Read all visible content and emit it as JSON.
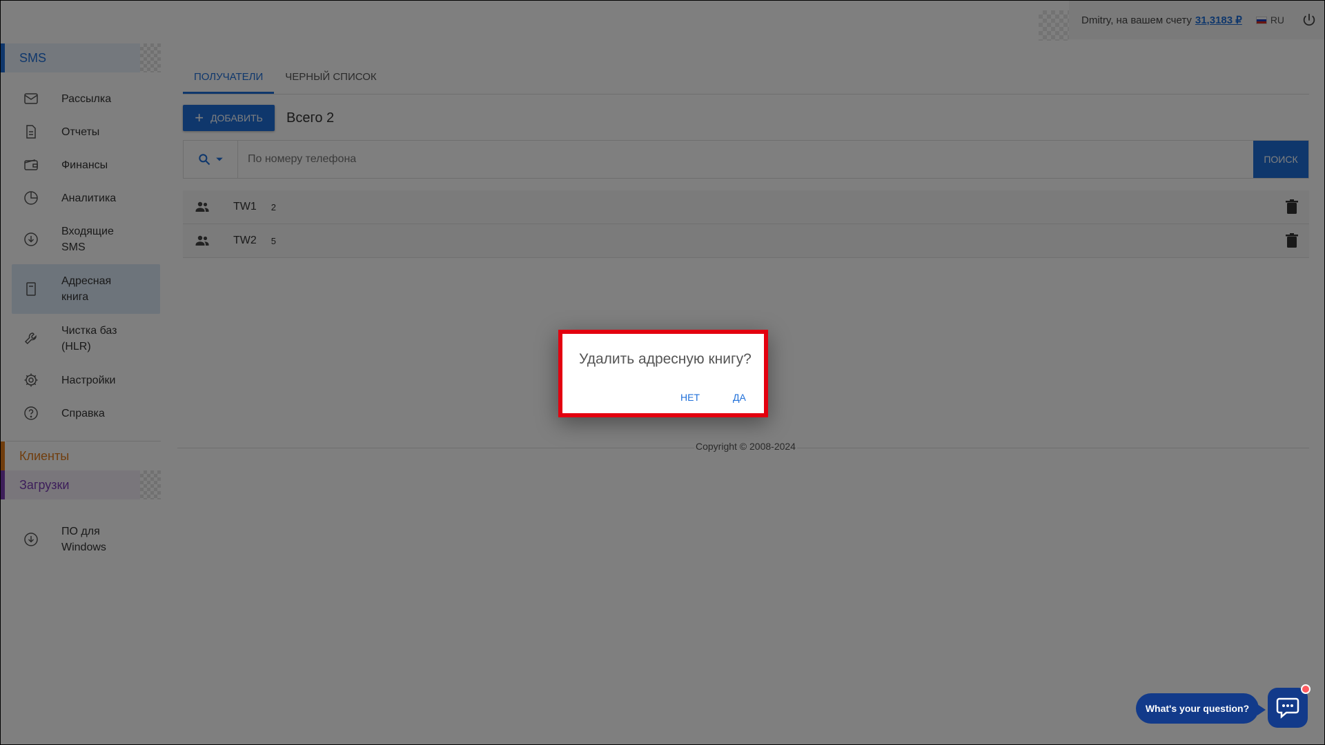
{
  "topbar": {
    "greeting": "Dmitry, на вашем счету",
    "balance": "31,3183 ₽",
    "lang": "RU"
  },
  "sidebar": {
    "sms_header": "SMS",
    "items": [
      {
        "label": "Рассылка",
        "icon": "mail-icon"
      },
      {
        "label": "Отчеты",
        "icon": "document-icon"
      },
      {
        "label": "Финансы",
        "icon": "wallet-icon"
      },
      {
        "label": "Аналитика",
        "icon": "pie-chart-icon"
      },
      {
        "label": "Входящие SMS",
        "icon": "inbox-download-icon"
      },
      {
        "label": "Адресная книга",
        "icon": "address-book-icon"
      },
      {
        "label": "Чистка баз (HLR)",
        "icon": "wrench-icon"
      },
      {
        "label": "Настройки",
        "icon": "gear-icon"
      },
      {
        "label": "Справка",
        "icon": "help-icon"
      }
    ],
    "clients_header": "Клиенты",
    "downloads_header": "Загрузки",
    "software_item": "ПО для Windows"
  },
  "main": {
    "tabs": [
      "ПОЛУЧАТЕЛИ",
      "ЧЕРНЫЙ СПИСОК"
    ],
    "add_label": "ДОБАВИТЬ",
    "total_label": "Всего 2",
    "search_placeholder": "По номеру телефона",
    "search_button": "ПОИСК",
    "rows": [
      {
        "name": "TW1",
        "count": "2"
      },
      {
        "name": "TW2",
        "count": "5"
      }
    ]
  },
  "footer": {
    "copyright": "Copyright © 2008-2024"
  },
  "dialog": {
    "title": "Удалить адресную книгу?",
    "no": "НЕТ",
    "yes": "ДА"
  },
  "chat": {
    "prompt": "What's your question?"
  },
  "colors": {
    "accent": "#1e6fd9",
    "clients": "#e07b1a",
    "downloads": "#7b3db5",
    "highlight": "#e3000f",
    "chat": "#123a8a"
  }
}
